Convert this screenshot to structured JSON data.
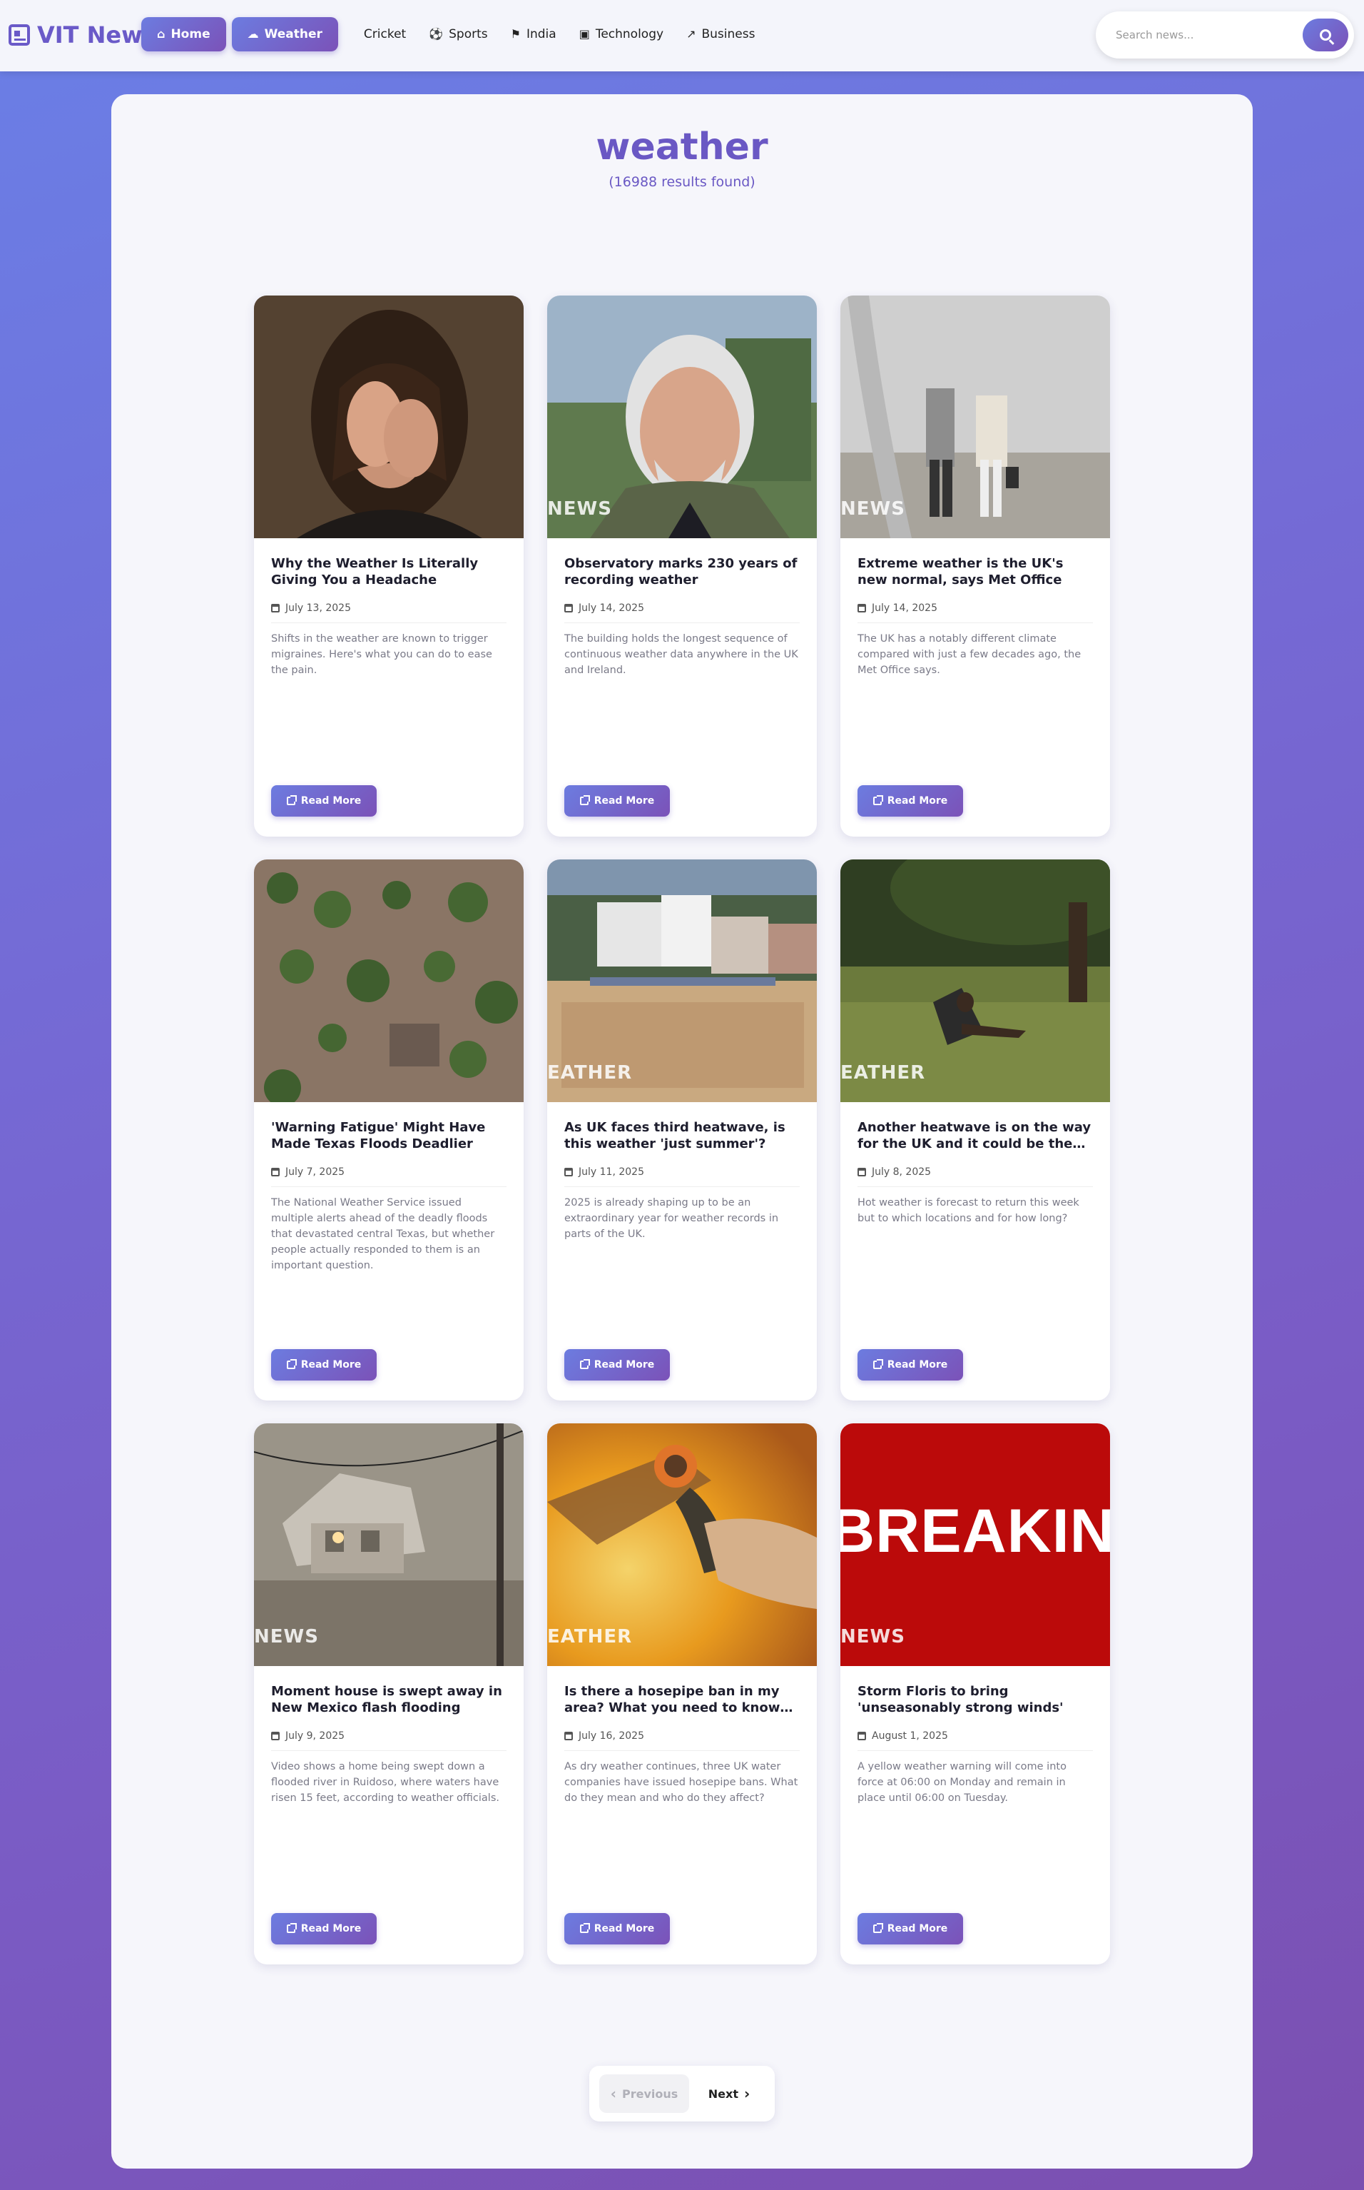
{
  "brand": {
    "name": "VIT News",
    "icon": "newspaper-icon"
  },
  "nav": {
    "items": [
      {
        "label": "Home",
        "icon": "home-icon",
        "active": true
      },
      {
        "label": "Weather",
        "icon": "cloud-icon",
        "active": true
      },
      {
        "label": "Cricket",
        "icon": "",
        "active": false
      },
      {
        "label": "Sports",
        "icon": "football-icon",
        "active": false
      },
      {
        "label": "India",
        "icon": "flag-icon",
        "active": false
      },
      {
        "label": "Technology",
        "icon": "microchip-icon",
        "active": false
      },
      {
        "label": "Business",
        "icon": "chart-line-icon",
        "active": false
      }
    ]
  },
  "search": {
    "placeholder": "Search news...",
    "value": ""
  },
  "page": {
    "title": "weather",
    "result_count": "(16988 results found)"
  },
  "articles": [
    {
      "title": "Why the Weather Is Literally Giving You a Headache",
      "date": "July 13, 2025",
      "summary": "Shifts in the weather are known to trigger migraines. Here's what you can do to ease the pain.",
      "image_tag": "",
      "read_more": "Read More"
    },
    {
      "title": "Observatory marks 230 years of recording weather",
      "date": "July 14, 2025",
      "summary": "The building holds the longest sequence of continuous weather data anywhere in the UK and Ireland.",
      "image_tag": "NEWS",
      "read_more": "Read More"
    },
    {
      "title": "Extreme weather is the UK's new normal, says Met Office",
      "date": "July 14, 2025",
      "summary": "The UK has a notably different climate compared with just a few decades ago, the Met Office says.",
      "image_tag": "NEWS",
      "read_more": "Read More"
    },
    {
      "title": "'Warning Fatigue' Might Have Made Texas Floods Deadlier",
      "date": "July 7, 2025",
      "summary": "The National Weather Service issued multiple alerts ahead of the deadly floods that devastated central Texas, but whether people actually responded to them is an important question.",
      "image_tag": "",
      "read_more": "Read More"
    },
    {
      "title": "As UK faces third heatwave, is this weather 'just summer'?",
      "date": "July 11, 2025",
      "summary": "2025 is already shaping up to be an extraordinary year for weather records in parts of the UK.",
      "image_tag": "EATHER",
      "read_more": "Read More"
    },
    {
      "title": "Another heatwave is on the way for the UK and it could be the longest...",
      "date": "July 8, 2025",
      "summary": "Hot weather is forecast to return this week but to which locations and for how long?",
      "image_tag": "EATHER",
      "read_more": "Read More"
    },
    {
      "title": "Moment house is swept away in New Mexico flash flooding",
      "date": "July 9, 2025",
      "summary": "Video shows a home being swept down a flooded river in Ruidoso, where waters have risen 15 feet, according to weather officials.",
      "image_tag": "NEWS",
      "read_more": "Read More"
    },
    {
      "title": "Is there a hosepipe ban in my area? What you need to know as...",
      "date": "July 16, 2025",
      "summary": "As dry weather continues, three UK water companies have issued hosepipe bans. What do they mean and who do they affect?",
      "image_tag": "EATHER",
      "read_more": "Read More"
    },
    {
      "title": "Storm Floris to bring 'unseasonably strong winds'",
      "date": "August 1, 2025",
      "summary": "A yellow weather warning will come into force at 06:00 on Monday and remain in place until 06:00 on Tuesday.",
      "image_tag": "NEWS",
      "image_text": "BREAKING",
      "read_more": "Read More"
    }
  ],
  "pagination": {
    "previous": "Previous",
    "next": "Next"
  },
  "colors": {
    "accent": "#6a58c4",
    "gradient_start": "#6c7ce0",
    "gradient_end": "#7b52b8"
  }
}
